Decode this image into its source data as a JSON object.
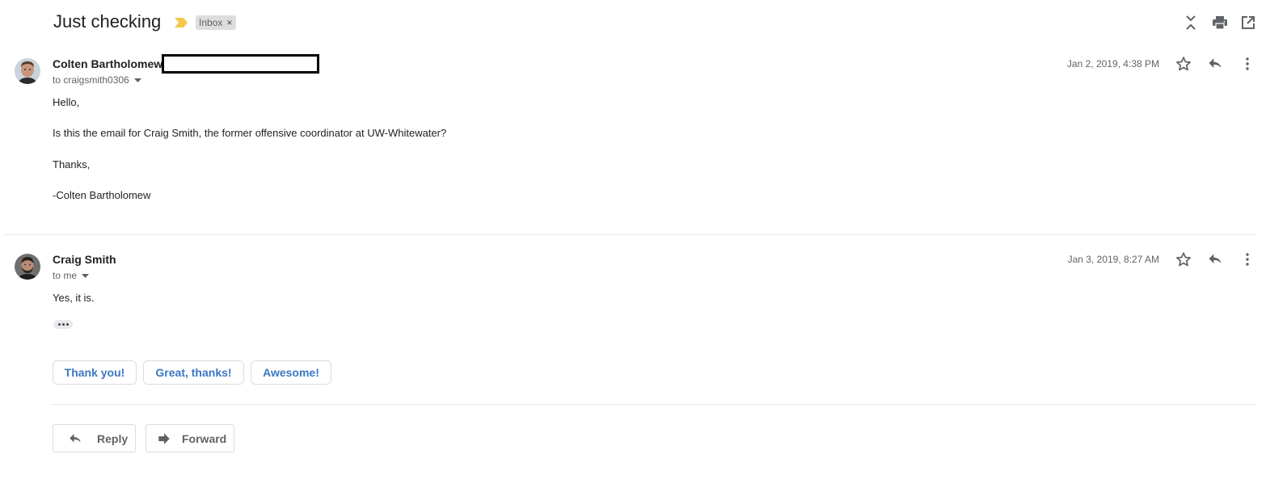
{
  "header": {
    "subject": "Just checking",
    "label": "Inbox",
    "label_remove": "×",
    "icons": [
      "collapse-all-icon",
      "print-icon",
      "open-in-new-window-icon"
    ]
  },
  "messages": [
    {
      "sender": "Colten Bartholomew",
      "recipient": "to craigsmith0306",
      "date": "Jan 2, 2019, 4:38 PM",
      "body": [
        "Hello,",
        "Is this the email for Craig Smith, the former offensive coordinator at UW-Whitewater?",
        "Thanks,",
        "-Colten Bartholomew"
      ]
    },
    {
      "sender": "Craig Smith",
      "recipient": "to me",
      "date": "Jan 3, 2019, 8:27 AM",
      "body": [
        "Yes, it is."
      ]
    }
  ],
  "smart_replies": [
    "Thank you!",
    "Great, thanks!",
    "Awesome!"
  ],
  "actions": {
    "reply": "Reply",
    "forward": "Forward"
  },
  "colors": {
    "accent": "#3b78c3",
    "importance_marker": "#f2c94c",
    "label_bg": "#dddddd"
  }
}
